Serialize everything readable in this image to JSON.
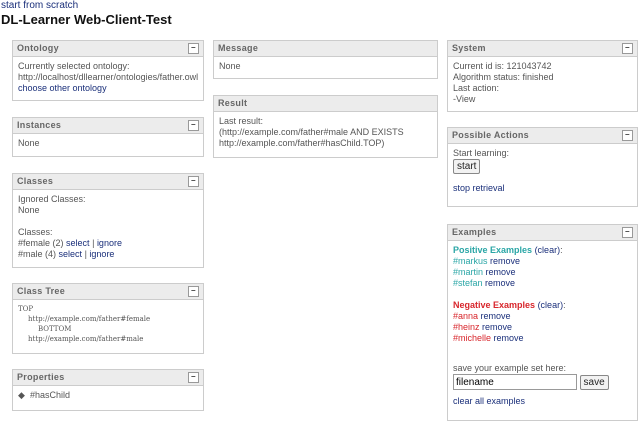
{
  "top_link": "start from scratch",
  "title": "DL-Learner Web-Client-Test",
  "ontology": {
    "title": "Ontology",
    "label": "Currently selected ontology:",
    "url": "http://localhost/dllearner/ontologies/father.owl",
    "link": "choose other ontology"
  },
  "instances": {
    "title": "Instances",
    "text": "None"
  },
  "classes": {
    "title": "Classes",
    "ignored_label": "Ignored Classes:",
    "ignored": "None",
    "classes_label": "Classes:",
    "items": [
      {
        "name": "#female (2)",
        "select": "select",
        "sep": "|",
        "ignore": "ignore"
      },
      {
        "name": "#male (4)",
        "select": "select",
        "sep": "|",
        "ignore": "ignore"
      }
    ]
  },
  "class_tree": {
    "title": "Class Tree",
    "lines": [
      "TOP",
      "http://example.com/father#female",
      "BOTTOM",
      "http://example.com/father#male"
    ]
  },
  "properties": {
    "title": "Properties",
    "items": [
      "#hasChild"
    ]
  },
  "message": {
    "title": "Message",
    "text": "None"
  },
  "result": {
    "title": "Result",
    "label": "Last result:",
    "line1": "(http://example.com/father#male AND EXISTS",
    "line2": "http://example.com/father#hasChild.TOP)"
  },
  "system": {
    "title": "System",
    "id": "Current id is: 121043742",
    "status": "Algorithm status: finished",
    "last_action": "Last action:",
    "view": "-View"
  },
  "actions": {
    "title": "Possible Actions",
    "start_label": "Start learning:",
    "start_button": "start",
    "stop": "stop retrieval"
  },
  "examples": {
    "title": "Examples",
    "pos_title": "Positive Examples",
    "neg_title": "Negative Examples",
    "clear": "(clear)",
    "colon": ":",
    "positive": [
      "#markus",
      "#martin",
      "#stefan"
    ],
    "negative": [
      "#anna",
      "#heinz",
      "#michelle"
    ],
    "remove": "remove",
    "save_label": "save your example set here:",
    "filename": "filename",
    "save_button": "save",
    "clear_all": "clear all examples"
  },
  "minimize": "–"
}
